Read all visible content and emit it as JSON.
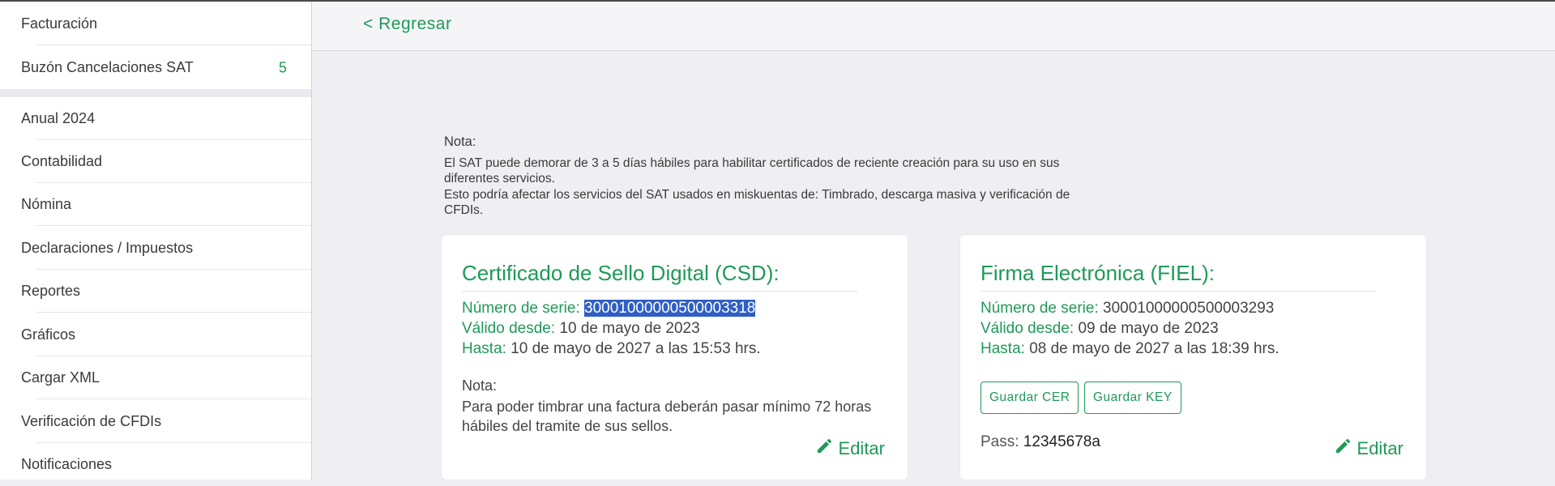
{
  "sidebar": {
    "items": [
      {
        "label": "Facturación"
      },
      {
        "label": "Buzón Cancelaciones SAT",
        "badge": "5"
      },
      {
        "label": "Anual 2024"
      },
      {
        "label": "Contabilidad"
      },
      {
        "label": "Nómina"
      },
      {
        "label": "Declaraciones / Impuestos"
      },
      {
        "label": "Reportes"
      },
      {
        "label": "Gráficos"
      },
      {
        "label": "Cargar XML"
      },
      {
        "label": "Verificación de CFDIs"
      },
      {
        "label": "Notificaciones"
      }
    ]
  },
  "header": {
    "back_label": "< Regresar"
  },
  "note": {
    "title": "Nota:",
    "line1": "El SAT puede demorar de 3 a 5 días hábiles para habilitar certificados de reciente creación para su uso en sus diferentes servicios.",
    "line2": "Esto podría afectar los servicios del SAT usados en miskuentas de: Timbrado, descarga masiva y verificación de CFDIs."
  },
  "csd": {
    "title": "Certificado de Sello Digital (CSD):",
    "serial_label": "Número de serie:",
    "serial_value": "30001000000500003318",
    "valid_from_label": "Válido desde:",
    "valid_from_value": "10 de mayo de 2023",
    "until_label": "Hasta:",
    "until_value": "10 de mayo de 2027 a las 15:53 hrs.",
    "note_title": "Nota:",
    "note_text": "Para poder timbrar una factura deberán pasar mínimo 72 horas hábiles del tramite de sus sellos.",
    "edit_label": "Editar"
  },
  "fiel": {
    "title": "Firma Electrónica (FIEL):",
    "serial_label": "Número de serie:",
    "serial_value": "30001000000500003293",
    "valid_from_label": "Válido desde:",
    "valid_from_value": "09 de mayo de 2023",
    "until_label": "Hasta:",
    "until_value": "08 de mayo de 2027 a las 18:39 hrs.",
    "save_cer_label": "Guardar CER",
    "save_key_label": "Guardar KEY",
    "pass_label": "Pass:",
    "pass_value": "12345678a",
    "edit_label": "Editar"
  },
  "colors": {
    "accent": "#1e9a57",
    "selection": "#2f5fc4",
    "background": "#efeff3"
  }
}
